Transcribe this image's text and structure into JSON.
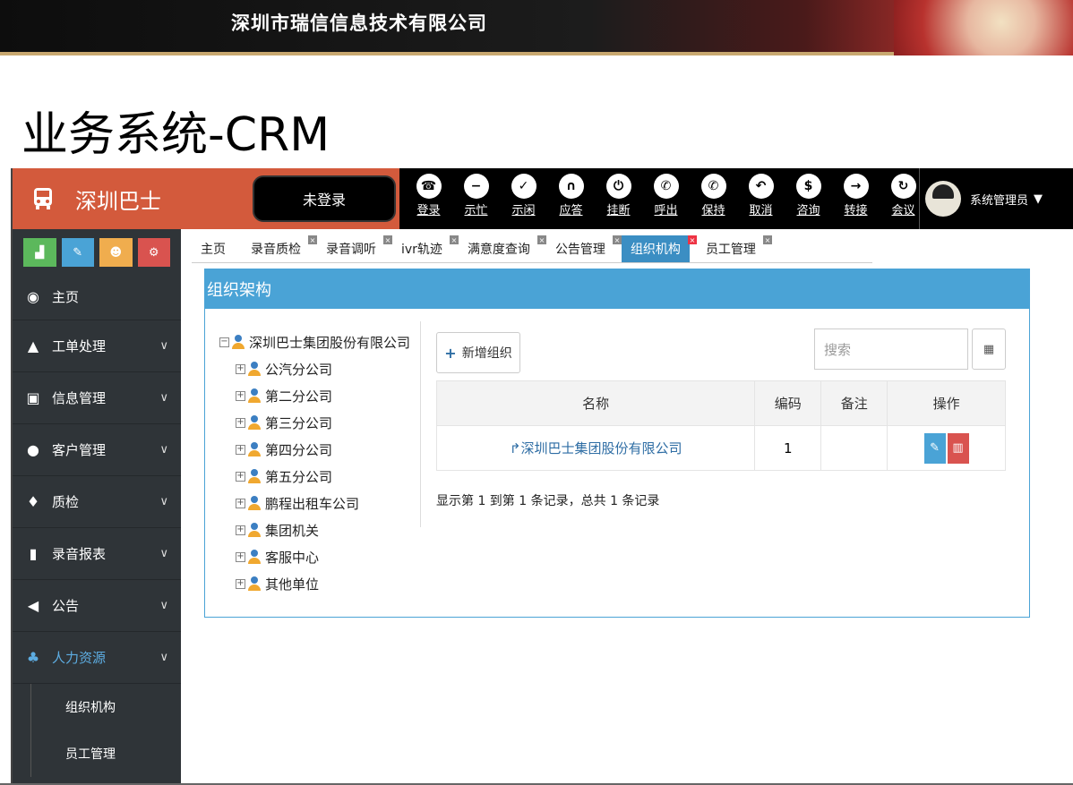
{
  "slide": {
    "company": "深圳市瑞信信息技术有限公司",
    "title": "业务系统-CRM"
  },
  "app": {
    "brand_name": "深圳巴士",
    "login_status": "未登录",
    "phone_buttons": [
      {
        "label": "登录",
        "icon": "login-icon"
      },
      {
        "label": "示忙",
        "icon": "busy-icon"
      },
      {
        "label": "示闲",
        "icon": "idle-icon"
      },
      {
        "label": "应答",
        "icon": "headset-icon"
      },
      {
        "label": "挂断",
        "icon": "hangup-icon"
      },
      {
        "label": "呼出",
        "icon": "call-out-icon"
      },
      {
        "label": "保持",
        "icon": "hold-icon"
      },
      {
        "label": "取消",
        "icon": "cancel-icon"
      },
      {
        "label": "咨询",
        "icon": "consult-icon"
      },
      {
        "label": "转接",
        "icon": "transfer-icon"
      },
      {
        "label": "会议",
        "icon": "conference-icon"
      }
    ],
    "user": "系统管理员",
    "shortcut_colors": [
      "#5cb85c",
      "#4aa3d6",
      "#f0ad4e",
      "#d9534f"
    ]
  },
  "sidebar": {
    "items": [
      {
        "label": "主页",
        "icon": "dashboard-icon",
        "chevron": false
      },
      {
        "label": "工单处理",
        "icon": "bell-icon",
        "chevron": true
      },
      {
        "label": "信息管理",
        "icon": "bus-icon",
        "chevron": true
      },
      {
        "label": "客户管理",
        "icon": "user-icon",
        "chevron": true
      },
      {
        "label": "质检",
        "icon": "mic-icon",
        "chevron": true
      },
      {
        "label": "录音报表",
        "icon": "bar-chart-icon",
        "chevron": true
      },
      {
        "label": "公告",
        "icon": "bullhorn-icon",
        "chevron": true
      },
      {
        "label": "人力资源",
        "icon": "sitemap-icon",
        "chevron": true,
        "active": true
      }
    ],
    "sub_items": [
      "组织机构",
      "员工管理"
    ]
  },
  "tabs": [
    {
      "label": "主页",
      "closable": false
    },
    {
      "label": "录音质检",
      "closable": true
    },
    {
      "label": "录音调听",
      "closable": true
    },
    {
      "label": "ivr轨迹",
      "closable": true
    },
    {
      "label": "满意度查询",
      "closable": true
    },
    {
      "label": "公告管理",
      "closable": true
    },
    {
      "label": "组织机构",
      "closable": true,
      "active": true
    },
    {
      "label": "员工管理",
      "closable": true
    }
  ],
  "panel": {
    "title": "组织架构",
    "tree_root": "深圳巴士集团股份有限公司",
    "tree_children": [
      "公汽分公司",
      "第二分公司",
      "第三分公司",
      "第四分公司",
      "第五分公司",
      "鹏程出租车公司",
      "集团机关",
      "客服中心",
      "其他单位"
    ],
    "add_button": "新增组织",
    "search_placeholder": "搜索",
    "table": {
      "headers": [
        "名称",
        "编码",
        "备注",
        "操作"
      ],
      "rows": [
        {
          "name": "深圳巴士集团股份有限公司",
          "code": "1",
          "note": ""
        }
      ]
    },
    "summary": "显示第 1 到第 1 条记录，总共 1 条记录"
  }
}
